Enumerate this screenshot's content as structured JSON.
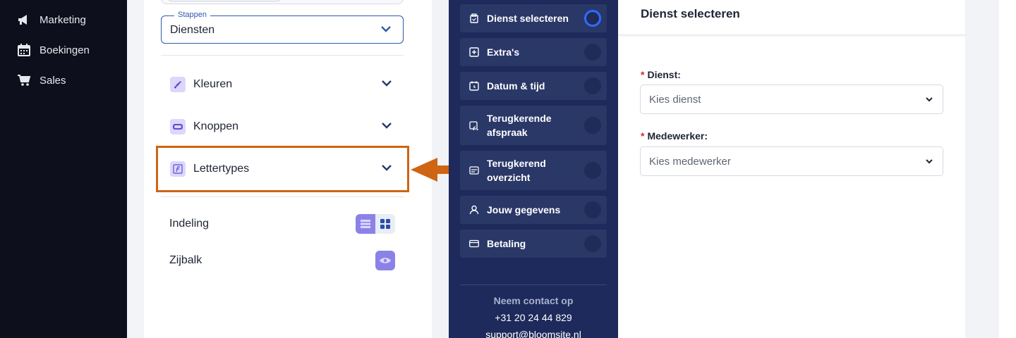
{
  "nav": {
    "items": [
      {
        "label": "Marketing",
        "icon": "megaphone-icon"
      },
      {
        "label": "Boekingen",
        "icon": "calendar-icon"
      },
      {
        "label": "Sales",
        "icon": "cart-icon"
      }
    ]
  },
  "panel": {
    "steps_legend": "Stappen",
    "steps_value": "Diensten",
    "accordions": [
      {
        "label": "Kleuren",
        "icon": "brush-icon"
      },
      {
        "label": "Knoppen",
        "icon": "button-icon"
      },
      {
        "label": "Lettertypes",
        "icon": "font-icon"
      }
    ],
    "indeling_label": "Indeling",
    "zijbalk_label": "Zijbalk"
  },
  "colors": {
    "highlight": "#cf6413",
    "accent": "#8b82e8",
    "preview_sidebar": "#1d2a5b",
    "active_step": "#2f6bff"
  },
  "preview": {
    "steps": [
      {
        "label": "Dienst selecteren",
        "icon": "service-select-icon",
        "active": true
      },
      {
        "label": "Extra's",
        "icon": "plus-square-icon",
        "active": false
      },
      {
        "label": "Datum & tijd",
        "icon": "calendar-clock-icon",
        "active": false
      },
      {
        "label": "Terugkerende afspraak",
        "icon": "recurring-icon",
        "active": false
      },
      {
        "label": "Terugkerend overzicht",
        "icon": "recurring-list-icon",
        "active": false
      },
      {
        "label": "Jouw gegevens",
        "icon": "user-icon",
        "active": false
      },
      {
        "label": "Betaling",
        "icon": "credit-card-icon",
        "active": false
      }
    ],
    "contact_heading": "Neem contact op",
    "contact_phone": "+31 20 24 44 829",
    "contact_email": "support@bloomsite.nl",
    "form_title": "Dienst selecteren",
    "dienst_label": "Dienst:",
    "dienst_placeholder": "Kies dienst",
    "medewerker_label": "Medewerker:",
    "medewerker_placeholder": "Kies medewerker",
    "required_mark": "*"
  }
}
